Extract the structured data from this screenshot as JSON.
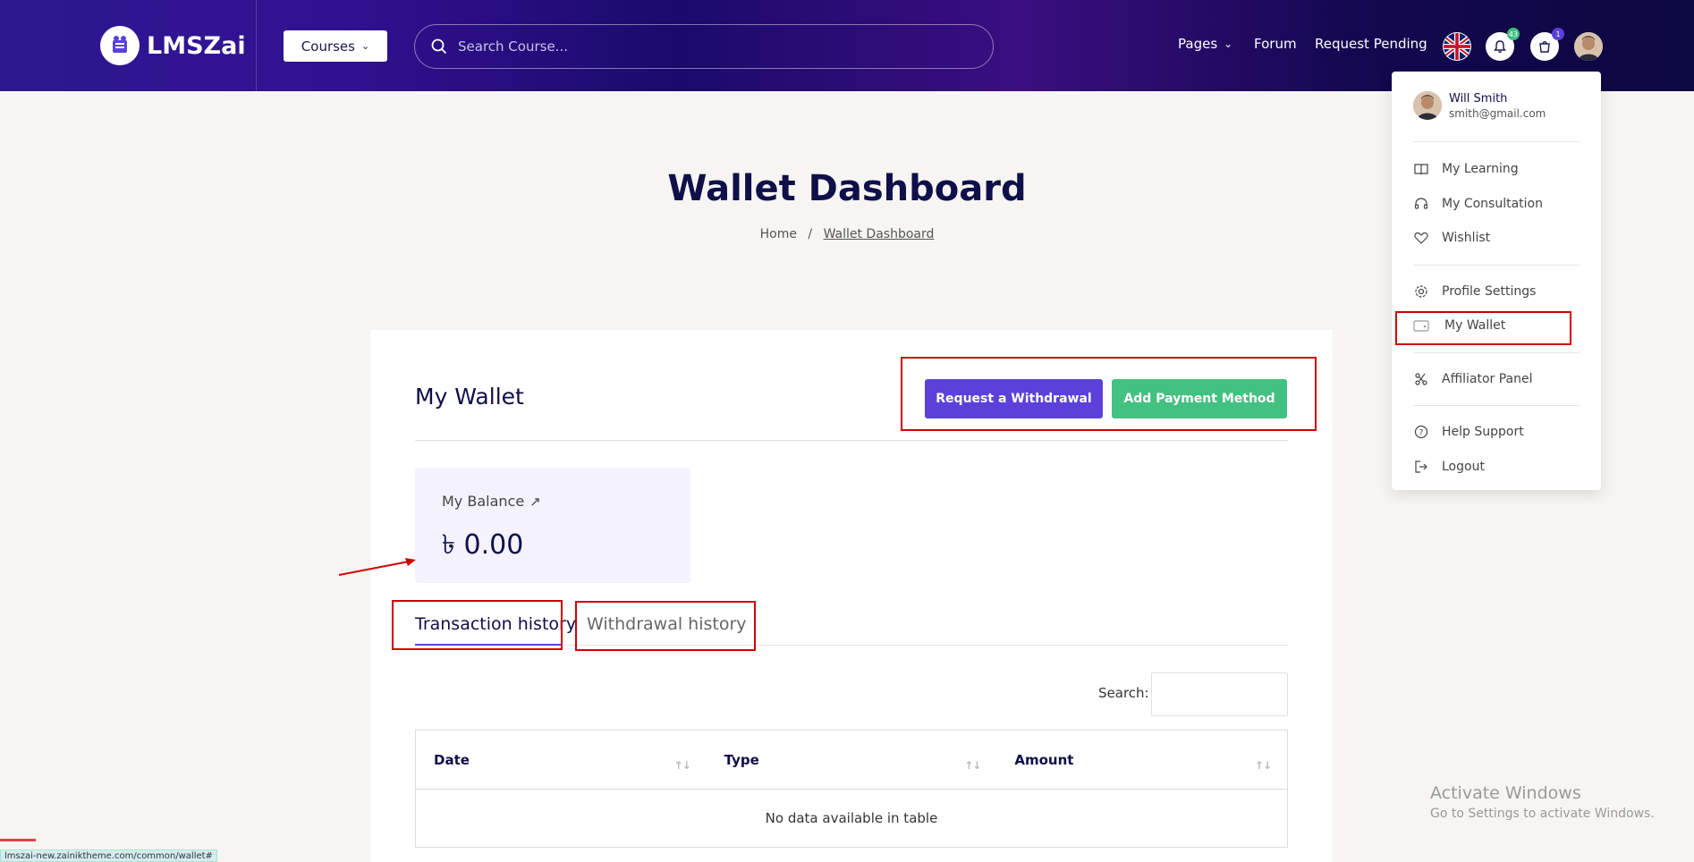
{
  "header": {
    "logo_text": "LMSZai",
    "courses_label": "Courses",
    "search_placeholder": "Search Course...",
    "nav_pages": "Pages",
    "nav_forum": "Forum",
    "nav_request": "Request Pending",
    "notification_count": "43",
    "cart_count": "1"
  },
  "page": {
    "title": "Wallet Dashboard",
    "breadcrumb_home": "Home",
    "breadcrumb_sep": "/",
    "breadcrumb_current": "Wallet Dashboard"
  },
  "wallet": {
    "title": "My Wallet",
    "withdraw_button": "Request a Withdrawal",
    "payment_button": "Add Payment Method",
    "balance_label": "My Balance",
    "balance_value": "৳ 0.00",
    "tab_transaction": "Transaction history",
    "tab_withdrawal": "Withdrawal history",
    "search_label": "Search:",
    "table": {
      "columns": [
        "Date",
        "Type",
        "Amount"
      ],
      "empty_message": "No data available in table"
    }
  },
  "dropdown": {
    "user_name": "Will Smith",
    "user_email": "smith@gmail.com",
    "items": [
      {
        "label": "My Learning",
        "icon": "book-icon"
      },
      {
        "label": "My Consultation",
        "icon": "headset-icon"
      },
      {
        "label": "Wishlist",
        "icon": "heart-icon"
      },
      {
        "label": "Profile Settings",
        "icon": "gear-icon"
      },
      {
        "label": "My Wallet",
        "icon": "wallet-icon"
      },
      {
        "label": "Affiliator Panel",
        "icon": "affiliate-icon"
      },
      {
        "label": "Help Support",
        "icon": "help-icon"
      },
      {
        "label": "Logout",
        "icon": "logout-icon"
      }
    ]
  },
  "overlay": {
    "activate_title": "Activate Windows",
    "activate_sub": "Go to Settings to activate Windows.",
    "status_url": "lmszai-new.zainiktheme.com/common/wallet#"
  },
  "colors": {
    "primary": "#5b41d9",
    "success": "#43c180",
    "highlight": "#d00000"
  }
}
